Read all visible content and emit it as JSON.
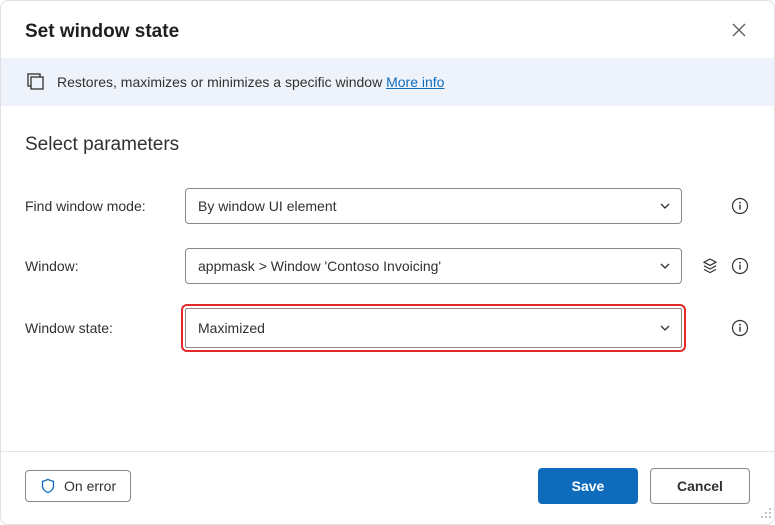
{
  "header": {
    "title": "Set window state"
  },
  "banner": {
    "text": "Restores, maximizes or minimizes a specific window ",
    "link_label": "More info"
  },
  "section_heading": "Select parameters",
  "fields": {
    "find_mode": {
      "label": "Find window mode:",
      "value": "By window UI element"
    },
    "window": {
      "label": "Window:",
      "value": "appmask > Window 'Contoso Invoicing'"
    },
    "state": {
      "label": "Window state:",
      "value": "Maximized"
    }
  },
  "footer": {
    "on_error": "On error",
    "save": "Save",
    "cancel": "Cancel"
  }
}
